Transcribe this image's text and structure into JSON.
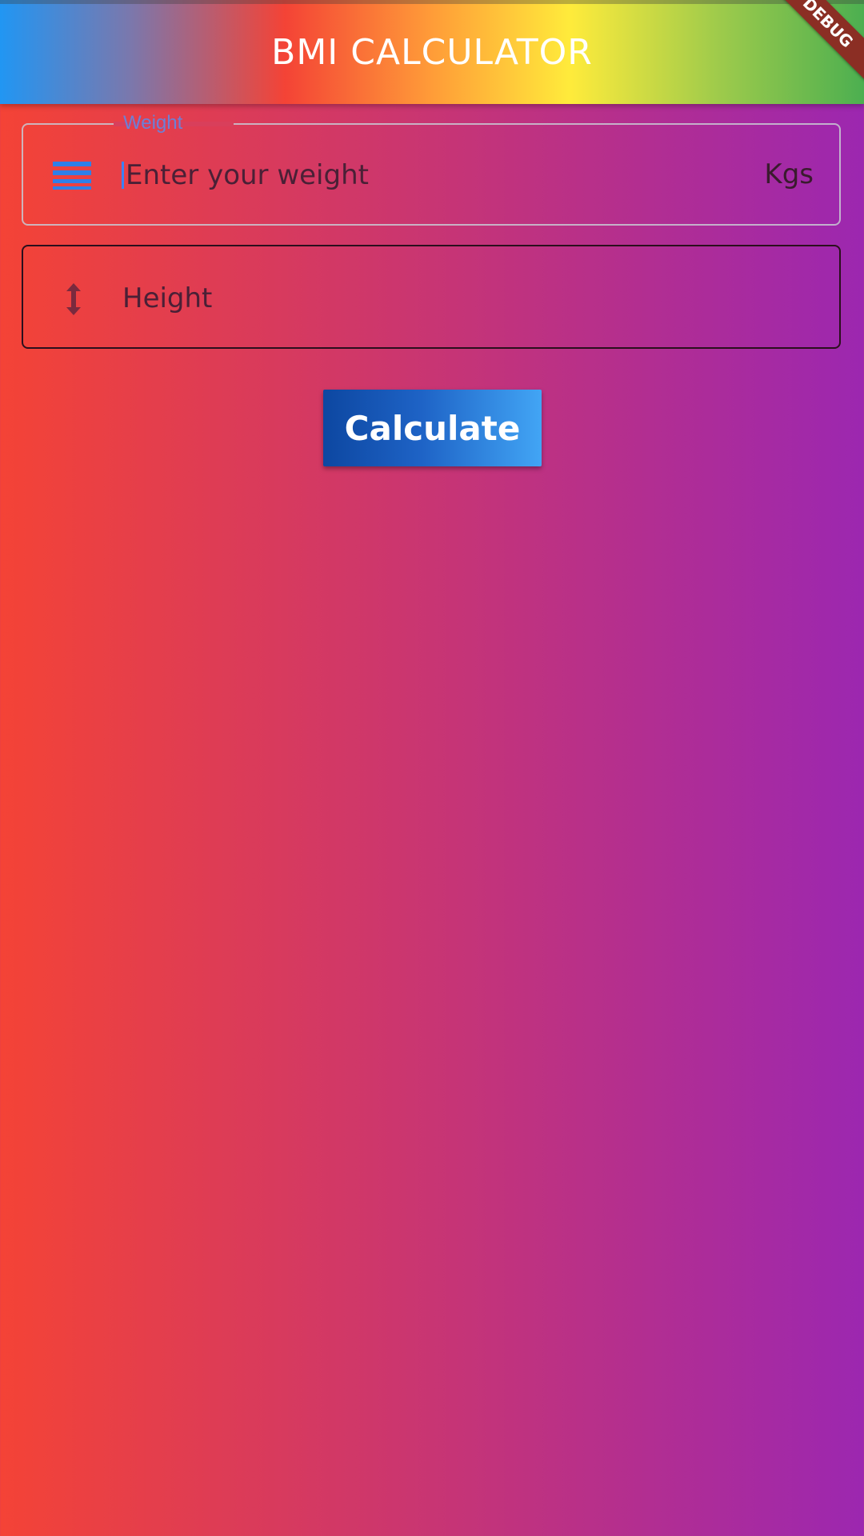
{
  "appbar": {
    "title": "BMI CALCULATOR",
    "debug_banner": "DEBUG"
  },
  "weight_field": {
    "label": "Weight",
    "placeholder": "Enter your weight",
    "value": "",
    "suffix": "Kgs",
    "icon": "list-icon"
  },
  "height_field": {
    "placeholder": "Height",
    "value": "",
    "icon": "vertical-arrows-icon"
  },
  "calculate_button": {
    "label": "Calculate"
  },
  "colors": {
    "background_start": "#F44336",
    "background_end": "#9C27B0",
    "button_start": "#0D47A1",
    "button_end": "#42A5F5",
    "focus_label": "#6D80D6",
    "icon_accent": "#3B82F6"
  }
}
